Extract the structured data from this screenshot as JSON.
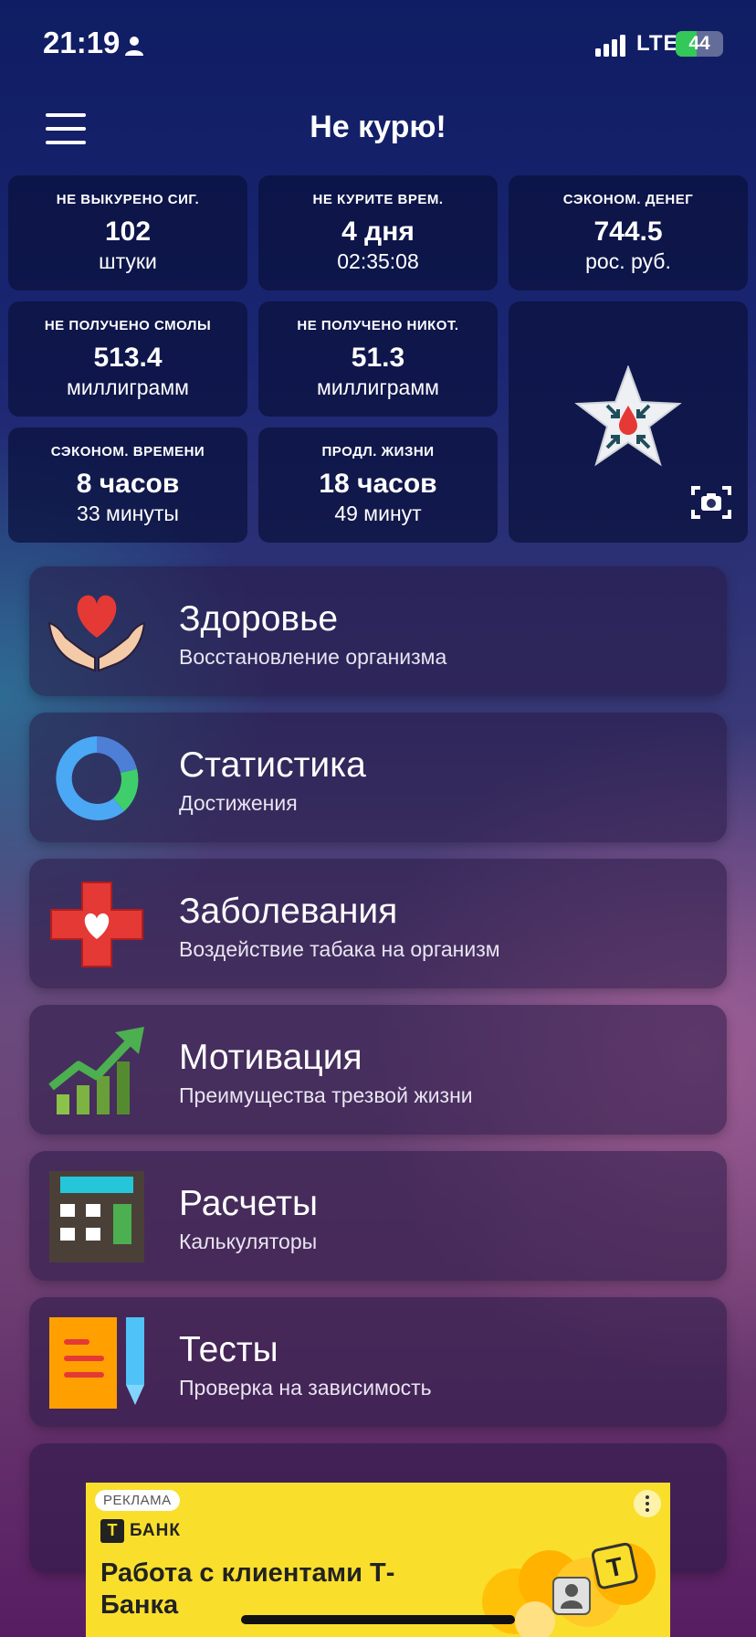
{
  "status": {
    "time": "21:19",
    "network": "LTE",
    "battery": 44
  },
  "header": {
    "title": "Не курю!"
  },
  "stats": [
    {
      "label": "НЕ ВЫКУРЕНО СИГ.",
      "value": "102",
      "unit": "штуки"
    },
    {
      "label": "НЕ КУРИТЕ ВРЕМ.",
      "value": "4 дня",
      "unit": "02:35:08"
    },
    {
      "label": "СЭКОНОМ. ДЕНЕГ",
      "value": "744.5",
      "unit": "рос. руб."
    },
    {
      "label": "НЕ ПОЛУЧЕНО СМОЛЫ",
      "value": "513.4",
      "unit": "миллиграмм"
    },
    {
      "label": "НЕ ПОЛУЧЕНО НИКОТ.",
      "value": "51.3",
      "unit": "миллиграмм"
    },
    {
      "label": "СЭКОНОМ. ВРЕМЕНИ",
      "value": "8 часов",
      "unit": "33 минуты"
    },
    {
      "label": "ПРОДЛ. ЖИЗНИ",
      "value": "18 часов",
      "unit": "49 минут"
    }
  ],
  "menu": [
    {
      "title": "Здоровье",
      "subtitle": "Восстановление организма",
      "icon": "heart-hands-icon"
    },
    {
      "title": "Статистика",
      "subtitle": "Достижения",
      "icon": "ring-chart-icon"
    },
    {
      "title": "Заболевания",
      "subtitle": "Воздействие табака на организм",
      "icon": "medical-cross-icon"
    },
    {
      "title": "Мотивация",
      "subtitle": "Преимущества трезвой жизни",
      "icon": "growth-chart-icon"
    },
    {
      "title": "Расчеты",
      "subtitle": "Калькуляторы",
      "icon": "calculator-icon"
    },
    {
      "title": "Тесты",
      "subtitle": "Проверка на зависимость",
      "icon": "notepad-pencil-icon"
    }
  ],
  "ad": {
    "tag": "РЕКЛАМА",
    "logo_letter": "Т",
    "brand": "БАНК",
    "title": "Работа с клиентами Т-Банка",
    "art_letter": "Т"
  },
  "colors": {
    "accent_red": "#e53935",
    "accent_green": "#4caf50",
    "ad_yellow": "#f9df2b",
    "battery_green": "#34c759"
  }
}
